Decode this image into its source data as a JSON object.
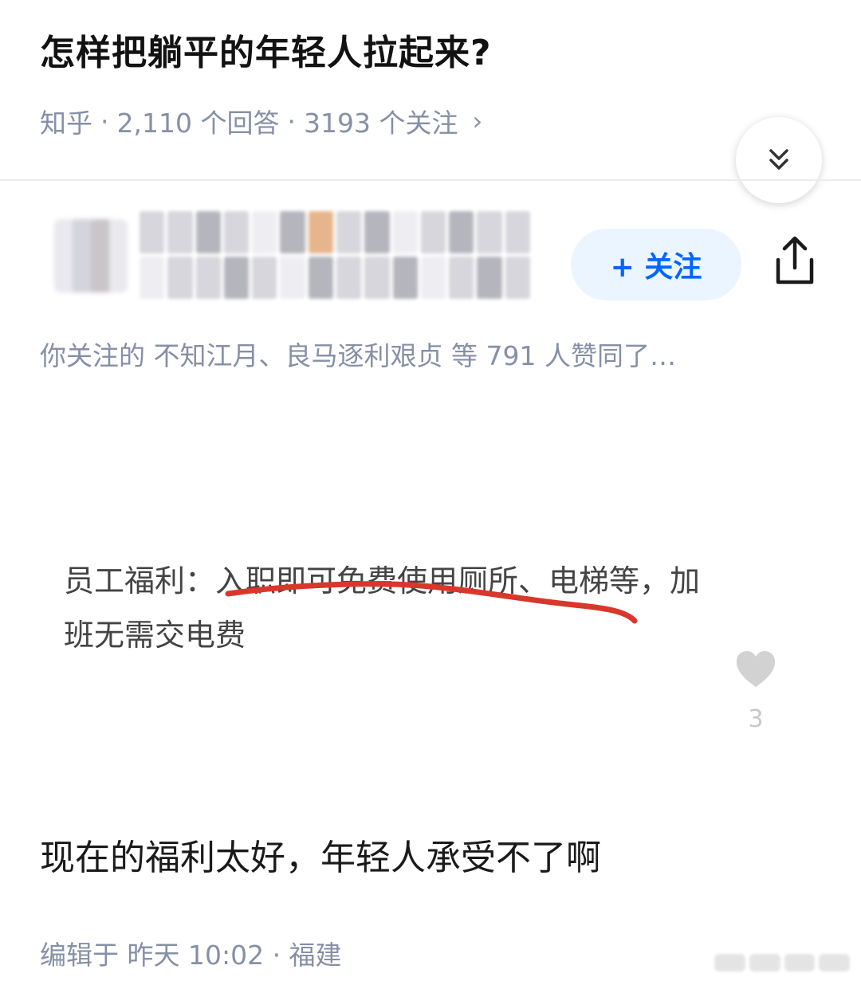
{
  "question": {
    "title": "怎样把躺平的年轻人拉起来?",
    "source": "知乎",
    "answers_count": "2,110 个回答",
    "followers_count": "3193 个关注",
    "separator": "·",
    "chevron": "›"
  },
  "author": {
    "follow_button": "+ 关注"
  },
  "answer": {
    "liked_by": "你关注的 不知江月、良马逐利艰贞 等 791 人赞同了…",
    "screenshot_line1": "员工福利：入职即可免费使用厕所、电梯等，加",
    "screenshot_line2": "班无需交电费",
    "like_count": "3",
    "body": "现在的福利太好，年轻人承受不了啊",
    "edit_info": "编辑于 昨天 10:02 · 福建"
  },
  "colors": {
    "accent": "#0066ff",
    "meta_gray": "#8590a6",
    "underline_red": "#d8382b"
  },
  "icons": [
    "double-chevron-down-icon",
    "share-icon",
    "heart-icon",
    "plus-icon"
  ]
}
